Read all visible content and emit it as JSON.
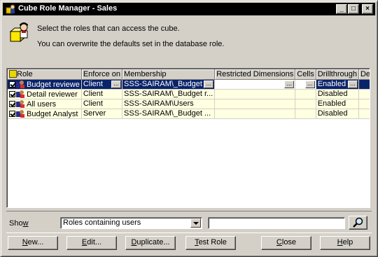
{
  "window": {
    "title": "Cube Role Manager - Sales",
    "minimize_glyph": "_",
    "maximize_glyph": "□",
    "close_glyph": "×"
  },
  "intro": {
    "line1": "Select the roles that can access the cube.",
    "line2": "You can overwrite the defaults set in the database role."
  },
  "grid": {
    "columns": [
      "Role",
      "Enforce on",
      "Membership",
      "Restricted Dimensions",
      "Cells",
      "Drillthrough",
      "Description"
    ],
    "rows": [
      {
        "role": "Budget reviewe",
        "enforce_on": "Client",
        "membership": "SSS-SAIRAM\\_Budget",
        "restricted_dimensions": "",
        "cells": "",
        "drillthrough": "Enabled",
        "description": "",
        "selected": true
      },
      {
        "role": "Detail reviewer",
        "enforce_on": "Client",
        "membership": "SSS-SAIRAM\\_Budget r...",
        "restricted_dimensions": "",
        "cells": "",
        "drillthrough": "Disabled",
        "description": "",
        "selected": false
      },
      {
        "role": "All users",
        "enforce_on": "Client",
        "membership": "SSS-SAIRAM\\Users",
        "restricted_dimensions": "",
        "cells": "",
        "drillthrough": "Enabled",
        "description": "",
        "selected": false
      },
      {
        "role": "Budget Analyst",
        "enforce_on": "Server",
        "membership": "SSS-SAIRAM\\_Budget ...",
        "restricted_dimensions": "",
        "cells": "",
        "drillthrough": "Disabled",
        "description": "",
        "selected": false
      }
    ],
    "ellipsis": "..."
  },
  "show": {
    "label_prefix": "Sho",
    "label_accel": "w",
    "selected": "Roles containing users",
    "search_value": ""
  },
  "buttons": {
    "new": {
      "accel": "N",
      "rest": "ew..."
    },
    "edit": {
      "accel": "E",
      "rest": "dit..."
    },
    "duplicate": {
      "accel": "D",
      "rest": "uplicate..."
    },
    "test_role": {
      "accel": "T",
      "rest": "est Role"
    },
    "close": {
      "accel": "C",
      "rest": "lose"
    },
    "help": {
      "accel": "H",
      "rest": "elp"
    }
  },
  "colors": {
    "selection": "#0a246a",
    "row_background": "#ffffe1",
    "dialog_face": "#d4d0c8",
    "titlebar": "#000000"
  },
  "icons": {
    "title": "cube-role-icon",
    "header": "user-key-icon",
    "role": "role-icon",
    "search": "magnifier-icon"
  }
}
